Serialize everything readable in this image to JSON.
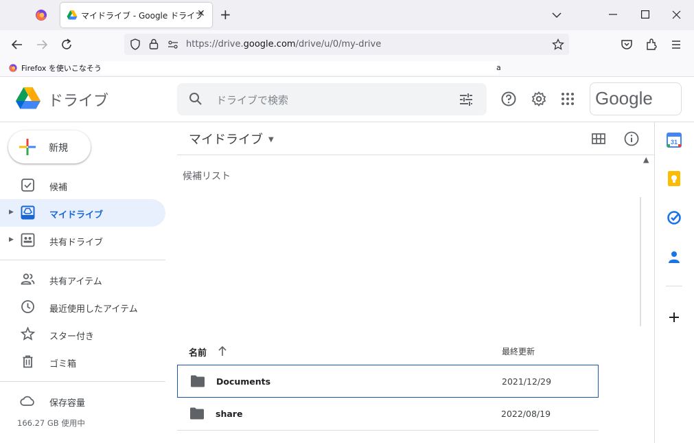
{
  "browser": {
    "tab_title": "マイドライブ - Google ドライブ",
    "close_tab": "✕",
    "new_tab": "+",
    "url_prefix": "https://drive.",
    "url_host": "google.com",
    "url_suffix": "/drive/u/0/my-drive",
    "bookmark_label": "Firefox を使いこなそう",
    "bookmark_tail": "a"
  },
  "header": {
    "product_name": "ドライブ",
    "search_placeholder": "ドライブで検索",
    "account_logo_text": "Google"
  },
  "sidebar": {
    "new_label": "新規",
    "items": [
      {
        "label": "候補",
        "icon": "check-box-icon"
      },
      {
        "label": "マイドライブ",
        "icon": "my-drive-icon",
        "active": true
      },
      {
        "label": "共有ドライブ",
        "icon": "shared-drive-icon"
      },
      {
        "label": "共有アイテム",
        "icon": "people-icon"
      },
      {
        "label": "最近使用したアイテム",
        "icon": "clock-icon"
      },
      {
        "label": "スター付き",
        "icon": "star-icon"
      },
      {
        "label": "ゴミ箱",
        "icon": "trash-icon"
      },
      {
        "label": "保存容量",
        "icon": "cloud-icon"
      }
    ],
    "storage_usage": "166.27 GB 使用中"
  },
  "main": {
    "breadcrumb": "マイドライブ",
    "suggested_heading": "候補リスト",
    "columns": {
      "name": "名前",
      "modified": "最終更新"
    },
    "files": [
      {
        "name": "Documents",
        "modified": "2021/12/29",
        "selected": true
      },
      {
        "name": "share",
        "modified": "2022/08/19",
        "selected": false
      }
    ]
  },
  "colors": {
    "accent": "#1967d2",
    "active_bg": "#e8f0fe",
    "selection_border": "#1a56a8"
  }
}
